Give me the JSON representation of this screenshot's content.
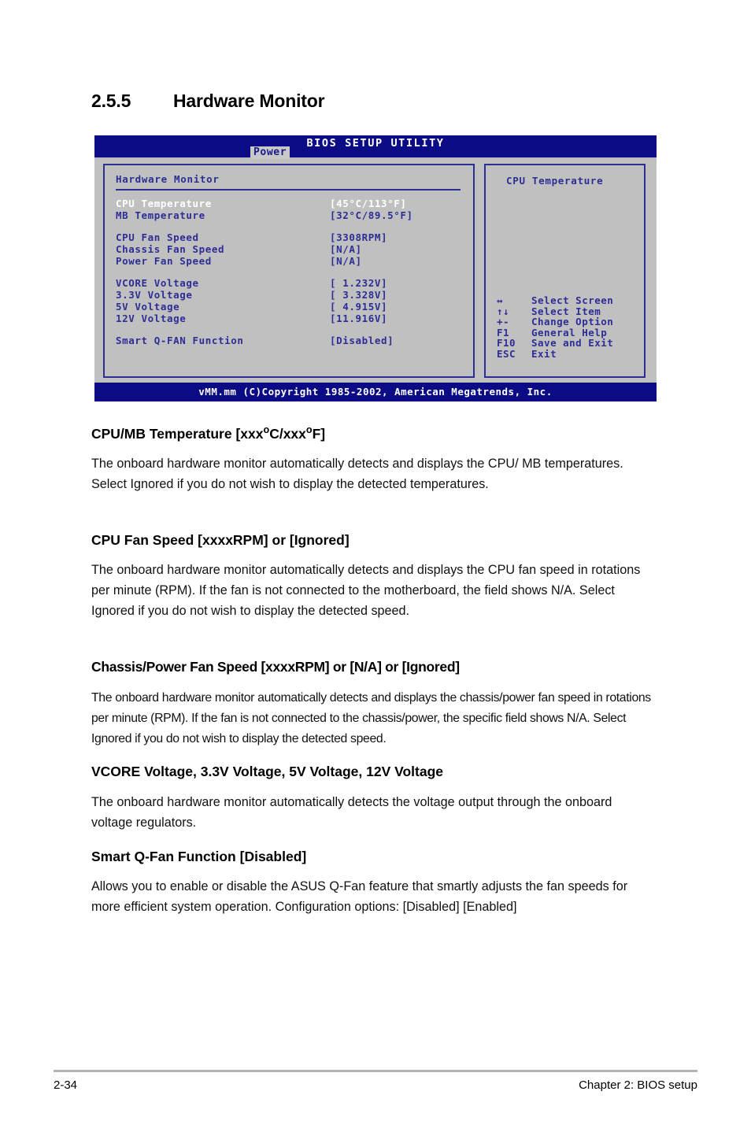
{
  "heading": {
    "number": "2.5.5",
    "title": "Hardware Monitor"
  },
  "bios": {
    "title": "BIOS SETUP UTILITY",
    "active_tab": "Power",
    "panel_title": "Hardware Monitor",
    "items": [
      {
        "label": "CPU Temperature",
        "value": "[45°C/113°F]",
        "selected": true
      },
      {
        "label": "MB Temperature",
        "value": "[32°C/89.5°F]",
        "selected": false
      },
      {
        "label": "",
        "value": "",
        "selected": false
      },
      {
        "label": "CPU Fan Speed",
        "value": "[3308RPM]",
        "selected": false
      },
      {
        "label": "Chassis Fan Speed",
        "value": "[N/A]",
        "selected": false
      },
      {
        "label": "Power Fan Speed",
        "value": "[N/A]",
        "selected": false
      },
      {
        "label": "",
        "value": "",
        "selected": false
      },
      {
        "label": "VCORE Voltage",
        "value": "[ 1.232V]",
        "selected": false
      },
      {
        "label": "3.3V Voltage",
        "value": "[ 3.328V]",
        "selected": false
      },
      {
        "label": "5V Voltage",
        "value": "[ 4.915V]",
        "selected": false
      },
      {
        "label": "12V Voltage",
        "value": "[11.916V]",
        "selected": false
      },
      {
        "label": "",
        "value": "",
        "selected": false
      },
      {
        "label": "Smart Q-FAN Function",
        "value": "[Disabled]",
        "selected": false
      }
    ],
    "help_title": "CPU Temperature",
    "legend": [
      {
        "key": "↔",
        "action": "Select Screen"
      },
      {
        "key": "↑↓",
        "action": "Select Item"
      },
      {
        "key": "+-",
        "action": "Change Option"
      },
      {
        "key": "F1",
        "action": "General Help"
      },
      {
        "key": "F10",
        "action": "Save and Exit"
      },
      {
        "key": "ESC",
        "action": "Exit"
      }
    ],
    "footer": "vMM.mm (C)Copyright 1985-2002, American Megatrends, Inc.",
    "colors": {
      "title_bar": "#0b0b86",
      "panel_bg": "#c0c0c0",
      "text": "#2d2d96",
      "selected_text": "#ffffff"
    }
  },
  "sections": [
    {
      "heading_pre": "CPU/MB Temperature [xxx",
      "heading_mid": "C/xxx",
      "heading_post": "F]",
      "body": "The onboard hardware monitor automatically detects and displays the CPU/ MB temperatures. Select Ignored if you do not wish to display the detected temperatures."
    },
    {
      "heading": "CPU Fan Speed [xxxxRPM] or [Ignored]",
      "body": "The onboard hardware monitor automatically detects and displays the CPU fan speed in rotations per minute (RPM). If the fan is not connected to the motherboard, the field shows N/A. Select Ignored if you do not wish to display the detected speed."
    },
    {
      "heading": "Chassis/Power Fan Speed [xxxxRPM] or [N/A] or [Ignored]",
      "body": "The onboard hardware monitor automatically detects and displays the chassis/power fan speed in rotations per minute (RPM). If the fan is not connected to the chassis/power, the specific field shows N/A. Select Ignored if you do not wish to display the detected speed."
    },
    {
      "heading": "VCORE Voltage, 3.3V Voltage, 5V Voltage, 12V Voltage",
      "body": "The onboard hardware monitor automatically detects the voltage output through the onboard voltage regulators."
    },
    {
      "heading": "Smart Q-Fan Function [Disabled]",
      "body": "Allows you to enable or disable the ASUS Q-Fan feature that smartly adjusts the fan speeds for more efficient system operation. Configuration options: [Disabled] [Enabled]"
    }
  ],
  "page_footer": {
    "page_number": "2-34",
    "chapter": "Chapter 2: BIOS setup"
  }
}
